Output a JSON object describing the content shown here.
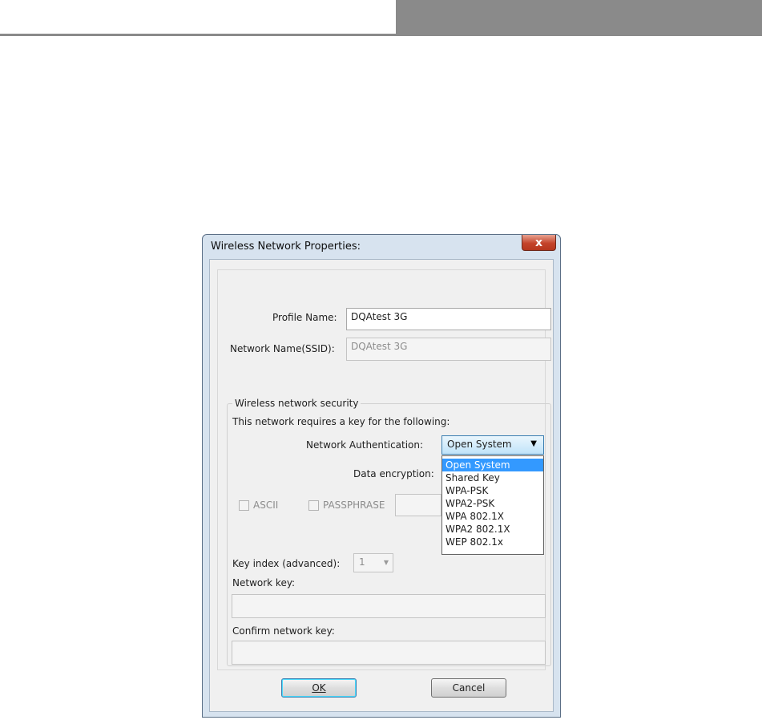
{
  "dialog": {
    "title": "Wireless Network Properties:",
    "close_symbol": "x"
  },
  "profile": {
    "label": "Profile Name:",
    "value": "DQAtest  3G"
  },
  "ssid": {
    "label": "Network Name(SSID):",
    "value": "DQAtest  3G"
  },
  "security": {
    "group_title": "Wireless network security",
    "requires_key_text": "This network requires a key for the following:",
    "auth_label": "Network Authentication:",
    "auth_selected": "Open System",
    "auth_options": [
      "Open System",
      "Shared Key",
      "WPA-PSK",
      "WPA2-PSK",
      "WPA 802.1X",
      "WPA2 802.1X",
      "WEP 802.1x"
    ],
    "encryption_label": "Data encryption:",
    "ascii_label": "ASCII",
    "passphrase_label": "PASSPHRASE",
    "key_index_label": "Key index (advanced):",
    "key_index_value": "1",
    "network_key_label": "Network key:",
    "confirm_key_label": "Confirm network key:"
  },
  "buttons": {
    "ok_label": "OK",
    "cancel_label": "Cancel"
  }
}
